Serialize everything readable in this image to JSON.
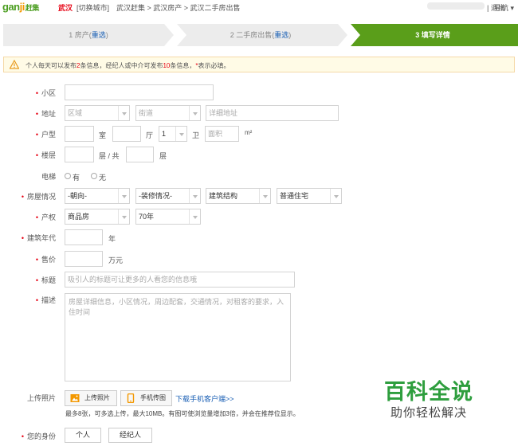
{
  "header": {
    "logo_main": "gan",
    "logo_o": "ji",
    "logo_tail": "赶集",
    "city": "武汉",
    "switch_city": "[切换城市]",
    "breadcrumb": "武汉赶集 > 武汉房产 > 武汉二手房出售",
    "logout": "| 退出",
    "nav": "导航 ▾"
  },
  "steps": [
    {
      "prefix": "1 房产(",
      "link": "重选",
      "suffix": ")"
    },
    {
      "prefix": "2 二手房出售(",
      "link": "重选",
      "suffix": ")"
    },
    {
      "label": "3 填写详情"
    }
  ],
  "colors": {
    "active_step": "#5a9e1a",
    "inactive_step": "#ececec",
    "accent": "#e60012",
    "link": "#1a5fb4"
  },
  "notice": {
    "t1": "个人每天可以发布",
    "n1": "2",
    "t2": "条信息，经纪人或中介可发布",
    "n2": "10",
    "t3": "条信息，",
    "star": "*",
    "t4": "表示必填。"
  },
  "form": {
    "xiaoqu": {
      "label": "小区"
    },
    "address": {
      "label": "地址",
      "district": "区域",
      "street": "街道",
      "detail_placeholder": "详细地址"
    },
    "huxing": {
      "label": "户型",
      "shi": "室",
      "ting": "厅",
      "wei_value": "1",
      "wei": "卫",
      "area_placeholder": "面积",
      "area_unit": "m²"
    },
    "floor": {
      "label": "楼层",
      "mid": "层 / 共",
      "end": "层"
    },
    "elevator": {
      "label": "电梯",
      "yes": "有",
      "no": "无"
    },
    "condition": {
      "label": "房屋情况",
      "orientation": "-朝向-",
      "decoration": "-装修情况-",
      "structure": "建筑结构",
      "type": "普通住宅"
    },
    "property": {
      "label": "产权",
      "kind": "商品房",
      "years": "70年"
    },
    "year_built": {
      "label": "建筑年代",
      "unit": "年"
    },
    "price": {
      "label": "售价",
      "unit": "万元"
    },
    "title": {
      "label": "标题",
      "placeholder": "吸引人的标题可让更多的人看您的信息哦"
    },
    "desc": {
      "label": "描述",
      "placeholder": "房屋详细信息，小区情况，周边配套，交通情况，对租客的要求，入住时间"
    },
    "photos": {
      "label": "上传照片",
      "upload_btn": "上传照片",
      "phone_btn": "手机传图",
      "download": "下载手机客户端>>",
      "hint": "最多8张，可多选上传，最大10MB。有图可使浏览量增加3倍，并会在推荐位显示。"
    },
    "identity": {
      "label": "您的身份",
      "personal": "个人",
      "agent": "经纪人"
    }
  },
  "watermark": {
    "main": "百科全说",
    "sub": "助你轻松解决"
  }
}
